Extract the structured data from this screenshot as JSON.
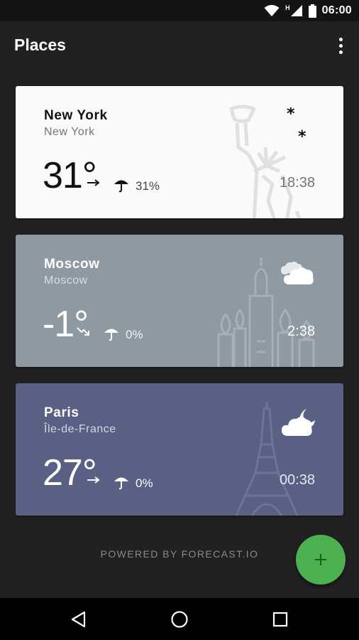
{
  "status_bar": {
    "network_label": "H",
    "time": "06:00",
    "icons": [
      "wifi-icon",
      "cell-signal-icon",
      "battery-icon"
    ]
  },
  "app_bar": {
    "title": "Places",
    "menu_icon": "overflow-menu-icon"
  },
  "places": [
    {
      "city": "New York",
      "region": "New York",
      "temperature": "31°",
      "trend_icon": "trend-steady-icon",
      "precip_icon": "umbrella-icon",
      "precipitation": "31%",
      "local_time": "18:38",
      "condition_icon": "snow-icon",
      "landmark_icon": "statue-of-liberty-icon",
      "background": "#fafafa"
    },
    {
      "city": "Moscow",
      "region": "Moscow",
      "temperature": "-1°",
      "trend_icon": "trend-down-icon",
      "precip_icon": "umbrella-icon",
      "precipitation": "0%",
      "local_time": "2:38",
      "condition_icon": "cloudy-icon",
      "landmark_icon": "st-basils-cathedral-icon",
      "background": "#8f99a1"
    },
    {
      "city": "Paris",
      "region": "Île-de-France",
      "temperature": "27°",
      "trend_icon": "trend-steady-icon",
      "precip_icon": "umbrella-icon",
      "precipitation": "0%",
      "local_time": "00:38",
      "condition_icon": "partly-cloudy-night-icon",
      "landmark_icon": "eiffel-tower-icon",
      "background": "#5a5f84"
    }
  ],
  "footer": {
    "powered_by": "POWERED BY FORECAST.IO"
  },
  "fab": {
    "icon": "plus-icon",
    "color": "#4caf50"
  },
  "nav_bar": {
    "icons": [
      "back-icon",
      "home-icon",
      "recents-icon"
    ]
  }
}
